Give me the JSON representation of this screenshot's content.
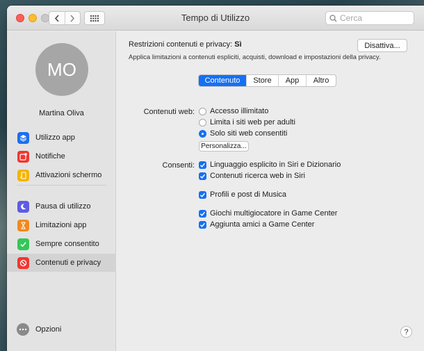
{
  "window": {
    "title": "Tempo di Utilizzo"
  },
  "search": {
    "placeholder": "Cerca"
  },
  "user": {
    "initials": "MO",
    "name": "Martina Oliva"
  },
  "sidebar": {
    "group1": [
      {
        "label": "Utilizzo app",
        "icon": "layers-icon",
        "color": "#1e6ef0"
      },
      {
        "label": "Notifiche",
        "icon": "notification-icon",
        "color": "#f2362f"
      },
      {
        "label": "Attivazioni schermo",
        "icon": "phone-icon",
        "color": "#f5b400"
      }
    ],
    "group2": [
      {
        "label": "Pausa di utilizzo",
        "icon": "moon-icon",
        "color": "#5e5ce6"
      },
      {
        "label": "Limitazioni app",
        "icon": "hourglass-icon",
        "color": "#f28a1c"
      },
      {
        "label": "Sempre consentito",
        "icon": "checkmark-icon",
        "color": "#34c759"
      },
      {
        "label": "Contenuti e privacy",
        "icon": "prohibited-icon",
        "color": "#f2362f"
      }
    ],
    "options_label": "Opzioni"
  },
  "header": {
    "restriction_label": "Restrizioni contenuti e privacy:",
    "restriction_value": "Sì",
    "description": "Applica limitazioni a contenuti espliciti, acquisti, download e impostazioni della privacy.",
    "disable_button": "Disattiva..."
  },
  "tabs": [
    "Contenuto",
    "Store",
    "App",
    "Altro"
  ],
  "active_tab": "Contenuto",
  "web_content": {
    "label": "Contenuti web:",
    "options": [
      "Accesso illimitato",
      "Limita i siti web per adulti",
      "Solo siti web consentiti"
    ],
    "selected": "Solo siti web consentiti",
    "customize_button": "Personalizza..."
  },
  "allow": {
    "label": "Consenti:",
    "items": [
      {
        "label": "Linguaggio esplicito in Siri e Dizionario",
        "checked": true
      },
      {
        "label": "Contenuti ricerca web in Siri",
        "checked": true
      },
      {
        "label": "Profili e post di Musica",
        "checked": true
      },
      {
        "label": "Giochi multigiocatore in Game Center",
        "checked": true
      },
      {
        "label": "Aggiunta amici a Game Center",
        "checked": true
      }
    ]
  },
  "help_label": "?",
  "colors": {
    "accent": "#1670f2"
  }
}
